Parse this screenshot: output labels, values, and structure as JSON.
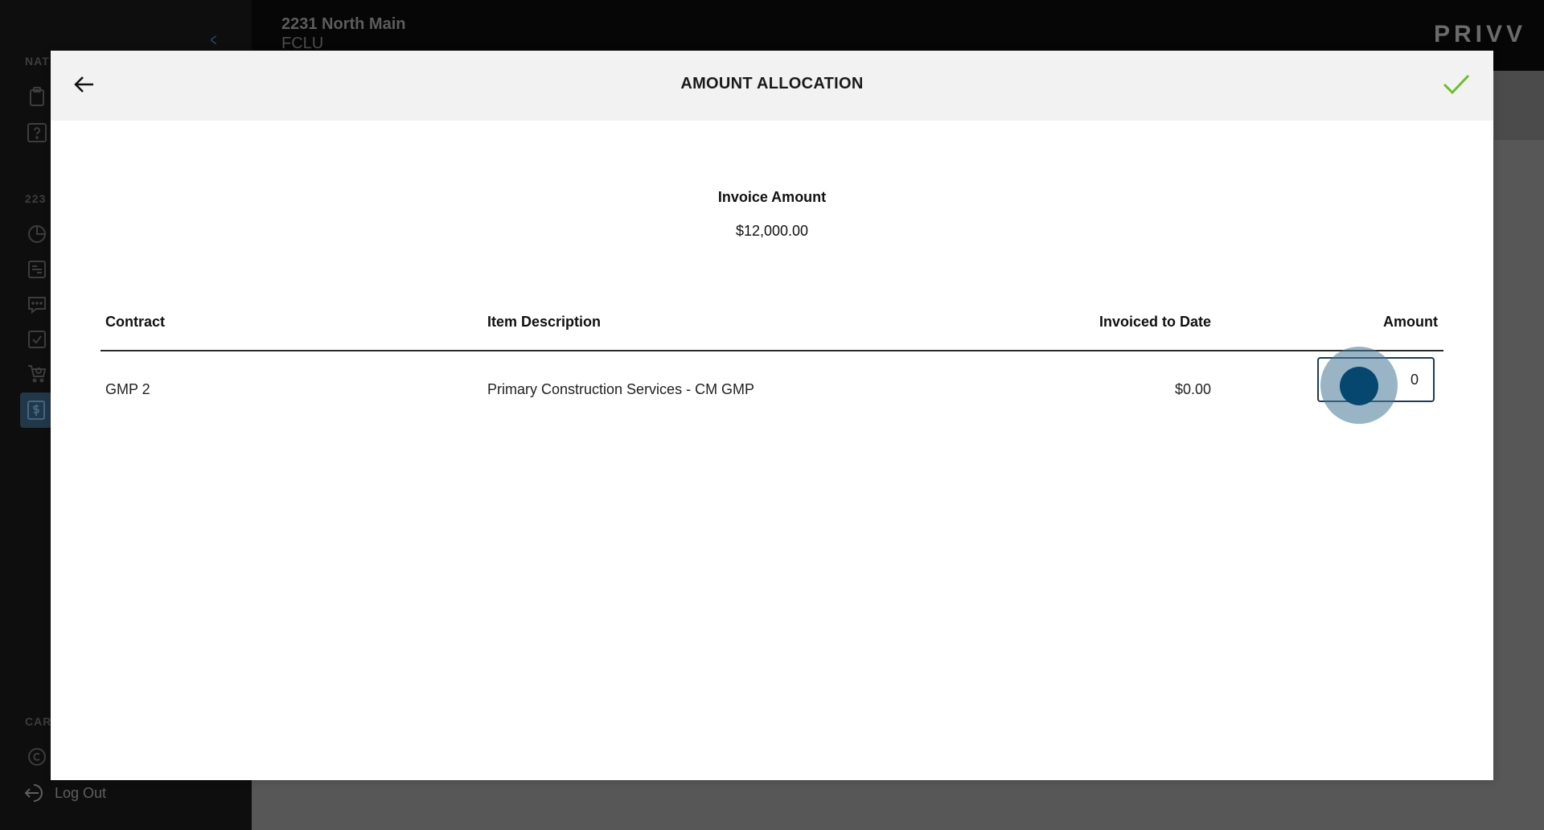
{
  "background": {
    "project_title": "2231 North Main",
    "project_subtitle": "FCLU",
    "brand": "PRIVV",
    "sidebar": {
      "section_1": "NAT",
      "section_2": "223",
      "section_3": "CAR",
      "logout_label": "Log Out"
    }
  },
  "modal": {
    "title": "AMOUNT ALLOCATION",
    "invoice_amount_label": "Invoice Amount",
    "invoice_amount_value": "$12,000.00",
    "table": {
      "headers": {
        "contract": "Contract",
        "item_description": "Item Description",
        "invoiced_to_date": "Invoiced to Date",
        "amount": "Amount"
      },
      "rows": [
        {
          "contract": "GMP 2",
          "item_description": "Primary Construction Services - CM GMP",
          "invoiced_to_date": "$0.00",
          "amount": "0"
        }
      ]
    }
  },
  "colors": {
    "accent_check": "#6cbf2a",
    "input_border": "#1d3b58",
    "touch_indicator": "#05476e"
  }
}
